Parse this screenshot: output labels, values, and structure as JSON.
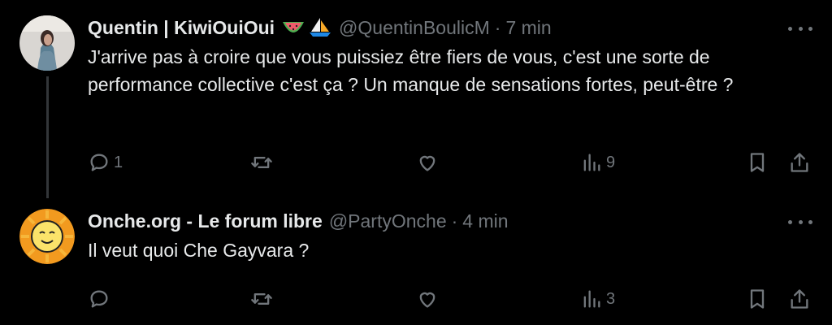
{
  "tweets": [
    {
      "name": "Quentin | KiwiOuiOui",
      "name_emojis": [
        "watermelon",
        "sailboat"
      ],
      "handle": "@QuentinBoulicM",
      "separator": "·",
      "time": "7 min",
      "text": "J'arrive pas à croire que vous puissiez être fiers de vous, c'est une sorte de performance collective c'est ça ? Un manque de sensations fortes, peut-être ?",
      "reply_count": "1",
      "views": "9"
    },
    {
      "name": "Onche.org - Le forum libre",
      "handle": "@PartyOnche",
      "separator": "·",
      "time": "4 min",
      "text": "Il veut quoi Che Gayvara ?",
      "views": "3"
    }
  ],
  "icons": {
    "reply": "reply-icon",
    "retweet": "retweet-icon",
    "like": "heart-icon",
    "views": "views-icon",
    "bookmark": "bookmark-icon",
    "share": "share-icon",
    "more": "more-icon"
  },
  "colors": {
    "background": "#000000",
    "text": "#e7e9ea",
    "muted": "#71767b"
  }
}
